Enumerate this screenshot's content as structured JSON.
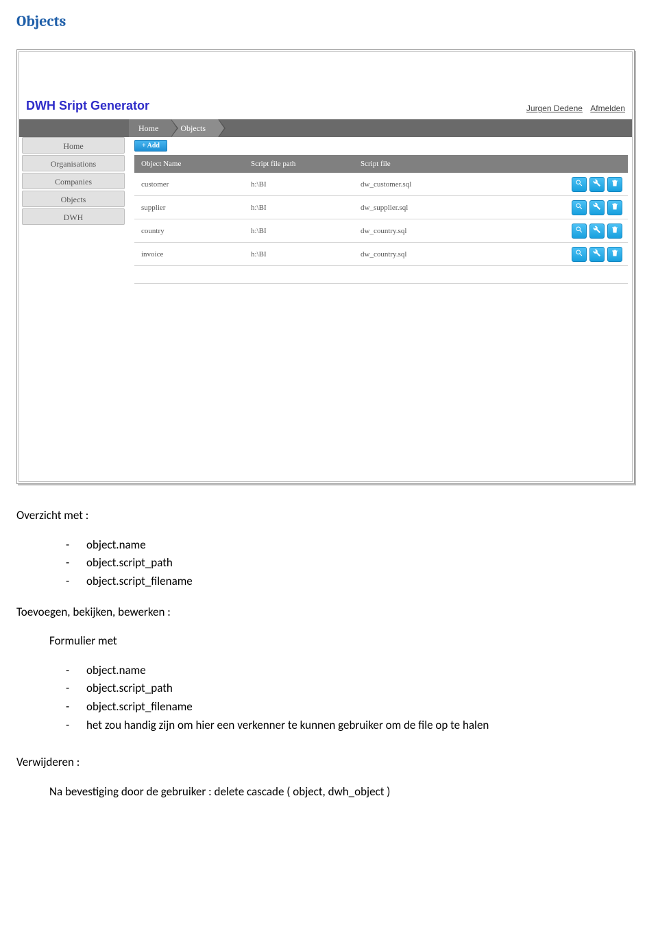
{
  "heading": "Objects",
  "app": {
    "title": "DWH Sript Generator",
    "user": "Jurgen Dedene",
    "logout": "Afmelden",
    "breadcrumbs": [
      "Home",
      "Objects"
    ],
    "sidebar": [
      "Home",
      "Organisations",
      "Companies",
      "Objects",
      "DWH"
    ],
    "add_label": "+ Add",
    "columns": [
      "Object Name",
      "Script file path",
      "Script file"
    ],
    "rows": [
      {
        "name": "customer",
        "path": "h:\\BI",
        "file": "dw_customer.sql"
      },
      {
        "name": "supplier",
        "path": "h:\\BI",
        "file": "dw_supplier.sql"
      },
      {
        "name": "country",
        "path": "h:\\BI",
        "file": "dw_country.sql"
      },
      {
        "name": "invoice",
        "path": "h:\\BI",
        "file": "dw_country.sql"
      }
    ]
  },
  "text": {
    "overzicht": "Overzicht met :",
    "list1": [
      "object.name",
      "object.script_path",
      "object.script_filename"
    ],
    "toevoegen": "Toevoegen, bekijken, bewerken :",
    "formulier": "Formulier met",
    "list2": [
      "object.name",
      "object.script_path",
      "object.script_filename",
      "het zou handig zijn om hier een verkenner te kunnen gebruiker om de file op te halen"
    ],
    "verwijderen": "Verwijderen :",
    "na": "Na bevestiging door de gebruiker : delete cascade ( object, dwh_object )"
  }
}
